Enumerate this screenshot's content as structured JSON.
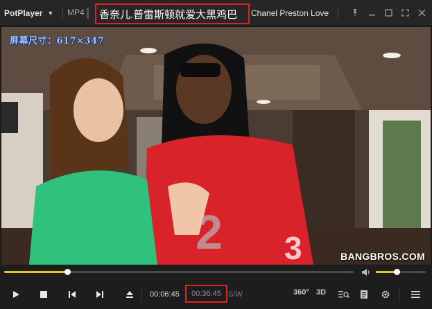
{
  "titlebar": {
    "app_name": "PotPlayer",
    "format": "MP4",
    "title_cn": "香奈儿.普雷斯顿就爱大黑鸡巴",
    "title_en": "Chanel Preston Love"
  },
  "video": {
    "osd_text": "屏幕尺寸：617×347",
    "watermark": "BANGBROS.COM"
  },
  "seek": {
    "progress": 0.18,
    "volume": 0.42
  },
  "controls": {
    "time_current": "00:06:45",
    "time_total": "00:36:45",
    "sw_label": "S/W",
    "vr_label": "360°",
    "threed_label": "3D"
  },
  "colors": {
    "accent": "#f0c419",
    "highlight": "#e2231a",
    "osd": "#9ec3ff"
  }
}
